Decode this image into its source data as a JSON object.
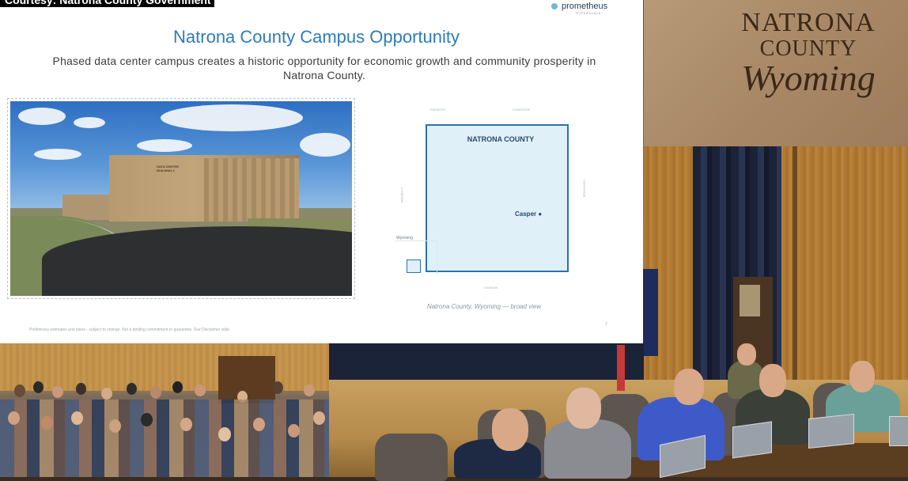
{
  "overlay": {
    "courtesy": "Courtesy: Natrona County Government"
  },
  "slide": {
    "logo": {
      "name": "prometheus",
      "sub": "HYPERSCALE"
    },
    "title": "Natrona County Campus Opportunity",
    "subtitle": "Phased data center campus creates a historic opportunity for economic growth and community prosperity in Natrona County.",
    "photo": {
      "sign": "DATA CENTER BUILDING 2"
    },
    "map": {
      "county_label": "NATRONA COUNTY",
      "city_label": "Casper",
      "state_label": "Wyoming",
      "neighbors": {
        "top_left": "FREMONT",
        "top_right": "CONVERSE",
        "left": "FREMONT",
        "right": "CONVERSE",
        "bottom": "CARBON"
      },
      "caption": "Natrona County, Wyoming — broad view"
    },
    "disclaimer": "Preliminary estimates and plans - subject to change. Not a binding commitment or guarantee. See Disclaimer slide.",
    "page_number": "2"
  },
  "backdrop": {
    "crest": {
      "line1": "NATRONA",
      "line2": "COUNTY",
      "line3": "Wyoming"
    }
  },
  "colors": {
    "title_blue": "#2e7cb8",
    "county_fill": "#dff0f8",
    "county_border": "#2f73a8"
  }
}
